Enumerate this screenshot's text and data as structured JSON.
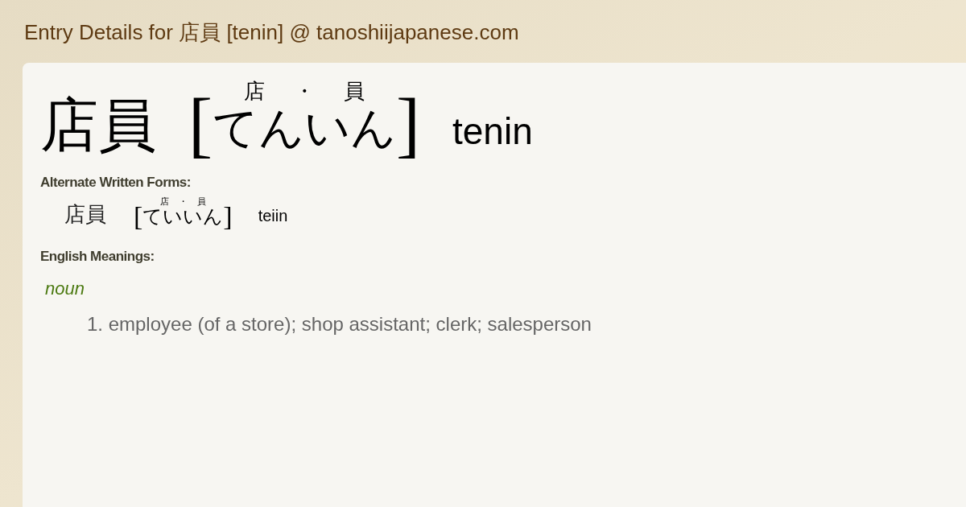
{
  "page_title": "Entry Details for 店員 [tenin] @ tanoshiijapanese.com",
  "entry": {
    "kanji": "店員",
    "furigana": [
      "店",
      "・",
      "員"
    ],
    "open_bracket": "[",
    "kana": "てんいん",
    "close_bracket": "]",
    "romaji": "tenin"
  },
  "alternate_forms": {
    "heading": "Alternate Written Forms:",
    "forms": [
      {
        "kanji": "店員",
        "furigana": [
          "店",
          "・",
          "員"
        ],
        "open_bracket": "[",
        "kana": "ていいん",
        "close_bracket": "]",
        "romaji": "teiin"
      }
    ]
  },
  "meanings": {
    "heading": "English Meanings:",
    "part_of_speech": "noun",
    "definitions": [
      "1. employee (of a store); shop assistant; clerk; salesperson"
    ]
  }
}
